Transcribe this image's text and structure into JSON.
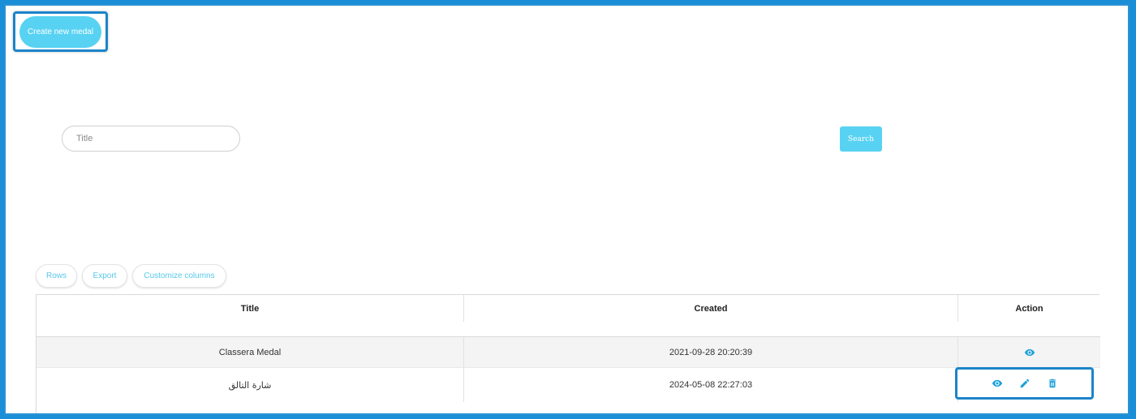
{
  "header": {
    "create_label": "Create new medal"
  },
  "search": {
    "placeholder": "Title",
    "button_label": "Search"
  },
  "toolbar": {
    "rows_label": "Rows",
    "export_label": "Export",
    "customize_label": "Customize columns"
  },
  "table": {
    "columns": [
      "Title",
      "Created",
      "Action"
    ],
    "rows": [
      {
        "title": "Classera Medal",
        "created": "2021-09-28 20:20:39",
        "actions": [
          "eye-icon"
        ]
      },
      {
        "title": "شارة التالق",
        "created": "2024-05-08 22:27:03",
        "actions": [
          "eye-icon",
          "pencil-icon",
          "trash-icon"
        ]
      }
    ]
  },
  "colors": {
    "accent": "#58d2f2",
    "icon": "#1ca0d8",
    "highlight": "#1c84c9"
  }
}
